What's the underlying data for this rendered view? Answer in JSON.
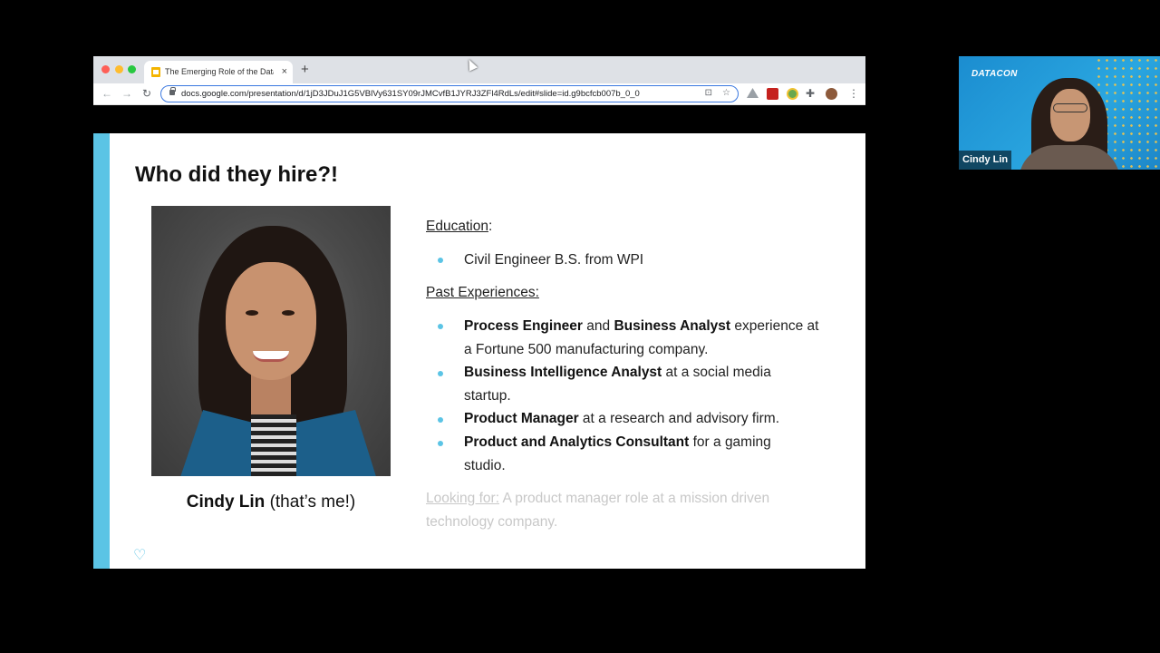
{
  "browser": {
    "tab": {
      "title": "The Emerging Role of the Data",
      "close_icon": "×"
    },
    "new_tab_icon": "+",
    "nav": {
      "back": "←",
      "forward": "→",
      "reload": "↻"
    },
    "url": "docs.google.com/presentation/d/1jD3JDuJ1G5VBlVy631SY09rJMCvfB1JYRJ3ZFl4RdLs/edit#slide=id.g9bcfcb007b_0_0",
    "cast_icon": "⊡",
    "star_icon": "☆",
    "extensions_icon": "✚",
    "menu_icon": "⋮"
  },
  "slide": {
    "title": "Who did they hire?!",
    "caption_name": "Cindy Lin",
    "caption_note": " (that’s me!)",
    "education_heading": "Education",
    "education_colon": ":",
    "education_item": "Civil Engineer B.S. from WPI",
    "experience_heading": "Past Experiences:",
    "experiences": [
      {
        "b1": "Process Engineer",
        "t1": " and ",
        "b2": "Business Analyst",
        "t2": " experience at a Fortune 500 manufacturing company."
      },
      {
        "b1": "Business Intelligence Analyst",
        "t1": " at a social media startup."
      },
      {
        "b1": "Product Manager",
        "t1": " at a research and advisory firm."
      },
      {
        "b1": "Product and Analytics Consultant",
        "t1": " for a gaming studio."
      }
    ],
    "looking_label": "Looking for:",
    "looking_text": " A product manager role at a mission driven technology company.",
    "logo_icon": "♡"
  },
  "webcam": {
    "brand": "DATACON",
    "participant_name": "Cindy Lin"
  },
  "colors": {
    "accent": "#5bc4e5",
    "omnibox_border": "#3a78e0",
    "webcam_bg": "#1b8dd0"
  }
}
